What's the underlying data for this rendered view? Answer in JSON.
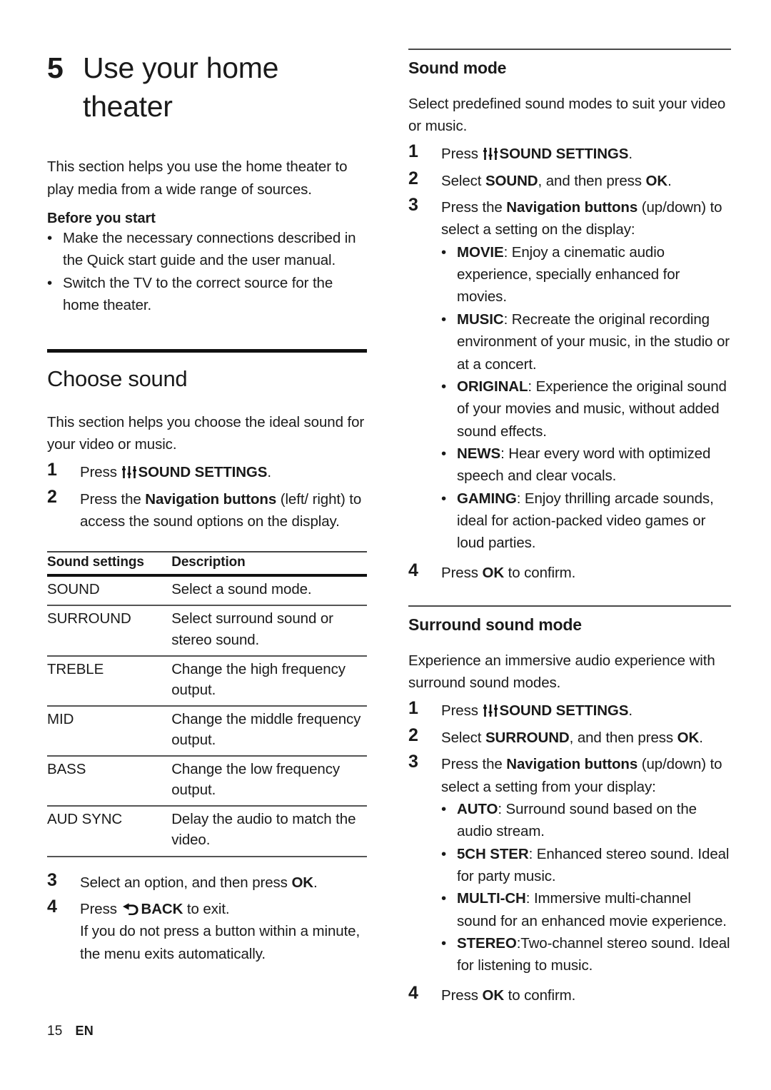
{
  "chapter": {
    "number": "5",
    "title": "Use your home theater",
    "intro": "This section helps you use the home theater to play media from a wide range of sources.",
    "before_you_start_heading": "Before you start",
    "before_you_start_items": [
      "Make the necessary connections described in the Quick start guide and the user manual.",
      "Switch the TV to the correct source for the home theater."
    ]
  },
  "choose_sound": {
    "heading": "Choose sound",
    "intro": "This section helps you choose the ideal sound for your video or music.",
    "steps": [
      {
        "num": "1",
        "pre": "Press ",
        "icon": "sliders-icon",
        "bold": "SOUND SETTINGS",
        "post": "."
      },
      {
        "num": "2",
        "pre": "Press the ",
        "bold": "Navigation buttons",
        "post": " (left/ right) to access the sound options on the display."
      }
    ],
    "table": {
      "headers": [
        "Sound settings",
        "Description"
      ],
      "rows": [
        [
          "SOUND",
          "Select a sound mode."
        ],
        [
          "SURROUND",
          "Select surround sound or stereo sound."
        ],
        [
          "TREBLE",
          "Change the high frequency output."
        ],
        [
          "MID",
          "Change the middle frequency output."
        ],
        [
          "BASS",
          "Change the low frequency output."
        ],
        [
          "AUD SYNC",
          "Delay the audio to match the video."
        ]
      ]
    },
    "steps_after": [
      {
        "num": "3",
        "pre": "Select an option, and then press ",
        "bold": "OK",
        "post": "."
      },
      {
        "num": "4",
        "pre": "Press ",
        "icon": "back-arrow-icon",
        "bold": "BACK",
        "post": " to exit.",
        "sub": "If you do not press a button within a minute, the menu exits automatically."
      }
    ]
  },
  "sound_mode": {
    "heading": "Sound mode",
    "intro": "Select predefined sound modes to suit your video or music.",
    "steps": [
      {
        "num": "1",
        "pre": "Press ",
        "icon": "sliders-icon",
        "bold": "SOUND SETTINGS",
        "post": "."
      },
      {
        "num": "2",
        "pre": "Select ",
        "bold": "SOUND",
        "post": ", and then press ",
        "bold2": "OK",
        "post2": "."
      },
      {
        "num": "3",
        "pre": "Press the ",
        "bold": "Navigation buttons",
        "post": " (up/down) to select a setting on the display:"
      }
    ],
    "options": [
      {
        "name": "MOVIE",
        "desc": ": Enjoy a cinematic audio experience, specially enhanced for movies."
      },
      {
        "name": "MUSIC",
        "desc": ": Recreate the original recording environment of your music, in the studio or at a concert."
      },
      {
        "name": "ORIGINAL",
        "desc": ": Experience the original sound of your movies and music, without added sound effects."
      },
      {
        "name": "NEWS",
        "desc": ": Hear every word with optimized speech and clear vocals."
      },
      {
        "name": "GAMING",
        "desc": ": Enjoy thrilling arcade sounds, ideal for action-packed video games or loud parties."
      }
    ],
    "final_step": {
      "num": "4",
      "pre": "Press ",
      "bold": "OK",
      "post": " to confirm."
    }
  },
  "surround_sound_mode": {
    "heading": "Surround sound mode",
    "intro": "Experience an immersive audio experience with surround sound modes.",
    "steps": [
      {
        "num": "1",
        "pre": "Press ",
        "icon": "sliders-icon",
        "bold": "SOUND SETTINGS",
        "post": "."
      },
      {
        "num": "2",
        "pre": "Select ",
        "bold": "SURROUND",
        "post": ", and then press ",
        "bold2": "OK",
        "post2": "."
      },
      {
        "num": "3",
        "pre": "Press the ",
        "bold": "Navigation buttons",
        "post": " (up/down) to select a setting from your display:"
      }
    ],
    "options": [
      {
        "name": "AUTO",
        "desc": ": Surround sound based on the audio stream."
      },
      {
        "name": "5CH STER",
        "desc": ": Enhanced stereo sound. Ideal for party music."
      },
      {
        "name": "MULTI-CH",
        "desc": ": Immersive multi-channel sound for an enhanced movie experience."
      },
      {
        "name": "STEREO",
        "desc": ":Two-channel stereo sound. Ideal for listening to music."
      }
    ],
    "final_step": {
      "num": "4",
      "pre": "Press ",
      "bold": "OK",
      "post": " to confirm."
    }
  },
  "footer": {
    "page_number": "15",
    "language": "EN"
  },
  "colors": {
    "text": "#1a1a1a",
    "rule_thick": "#111111",
    "rule_thin": "#4a4a4a",
    "background": "#ffffff"
  },
  "bullet_glyph": "•"
}
